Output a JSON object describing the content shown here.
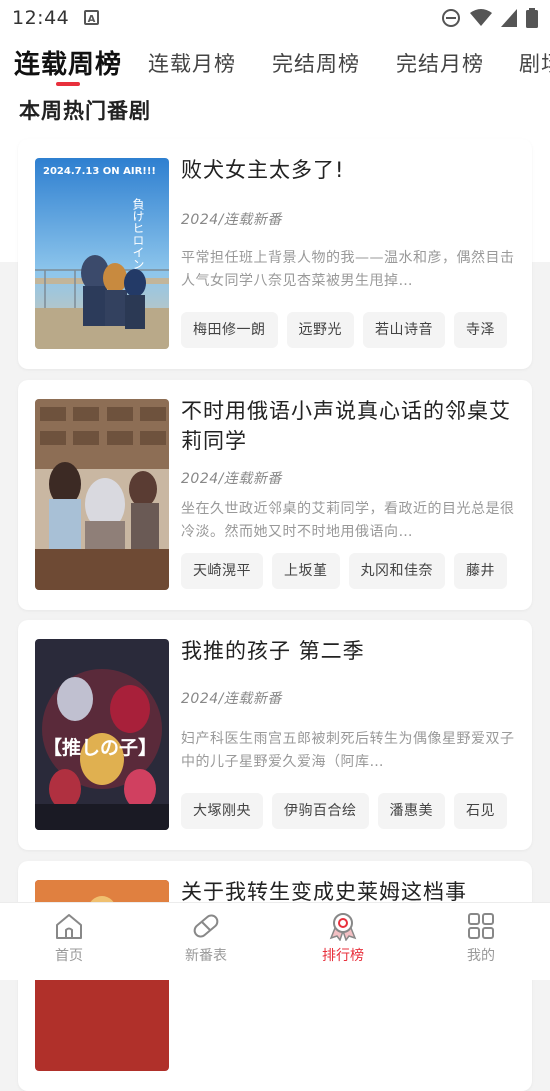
{
  "status_bar": {
    "time": "12:44",
    "notification_letter": "A"
  },
  "tabs": [
    {
      "label": "连载周榜"
    },
    {
      "label": "连载月榜"
    },
    {
      "label": "完结周榜"
    },
    {
      "label": "完结月榜"
    },
    {
      "label": "剧场"
    }
  ],
  "section_title": "本周热门番剧",
  "cards": [
    {
      "title": "败犬女主太多了!",
      "meta": "2024/连载新番",
      "description": "平常担任班上背景人物的我——温水和彦，偶然目击人气女同学八奈见杏菜被男生甩掉…",
      "cover_text": "2024.7.13 ON AIR!!!",
      "cast": [
        "梅田修一朗",
        "远野光",
        "若山诗音",
        "寺泽"
      ]
    },
    {
      "title": "不时用俄语小声说真心话的邻桌艾莉同学",
      "meta": "2024/连载新番",
      "description": "坐在久世政近邻桌的艾莉同学，看政近的目光总是很冷淡。然而她又时不时地用俄语向…",
      "cover_text": "",
      "cast": [
        "天崎滉平",
        "上坂堇",
        "丸冈和佳奈",
        "藤井"
      ]
    },
    {
      "title": "我推的孩子 第二季",
      "meta": "2024/连载新番",
      "description": "妇产科医生雨宫五郎被刺死后转生为偶像星野爱双子中的儿子星野爱久爱海（阿库…",
      "cover_text": "【推しの子】",
      "cast": [
        "大塚刚央",
        "伊驹百合绘",
        "潘惠美",
        "石见"
      ]
    },
    {
      "title": "关于我转生变成史莱姆这档事",
      "meta": "",
      "description": "",
      "cover_text": "",
      "cast": []
    }
  ],
  "bottom_nav": [
    {
      "label": "首页",
      "icon": "home-icon"
    },
    {
      "label": "新番表",
      "icon": "capsule-icon"
    },
    {
      "label": "排行榜",
      "icon": "ranking-medal-icon"
    },
    {
      "label": "我的",
      "icon": "grid-icon"
    }
  ],
  "colors": {
    "accent": "#e8303c",
    "background": "#f3f3f3",
    "card": "#ffffff"
  }
}
